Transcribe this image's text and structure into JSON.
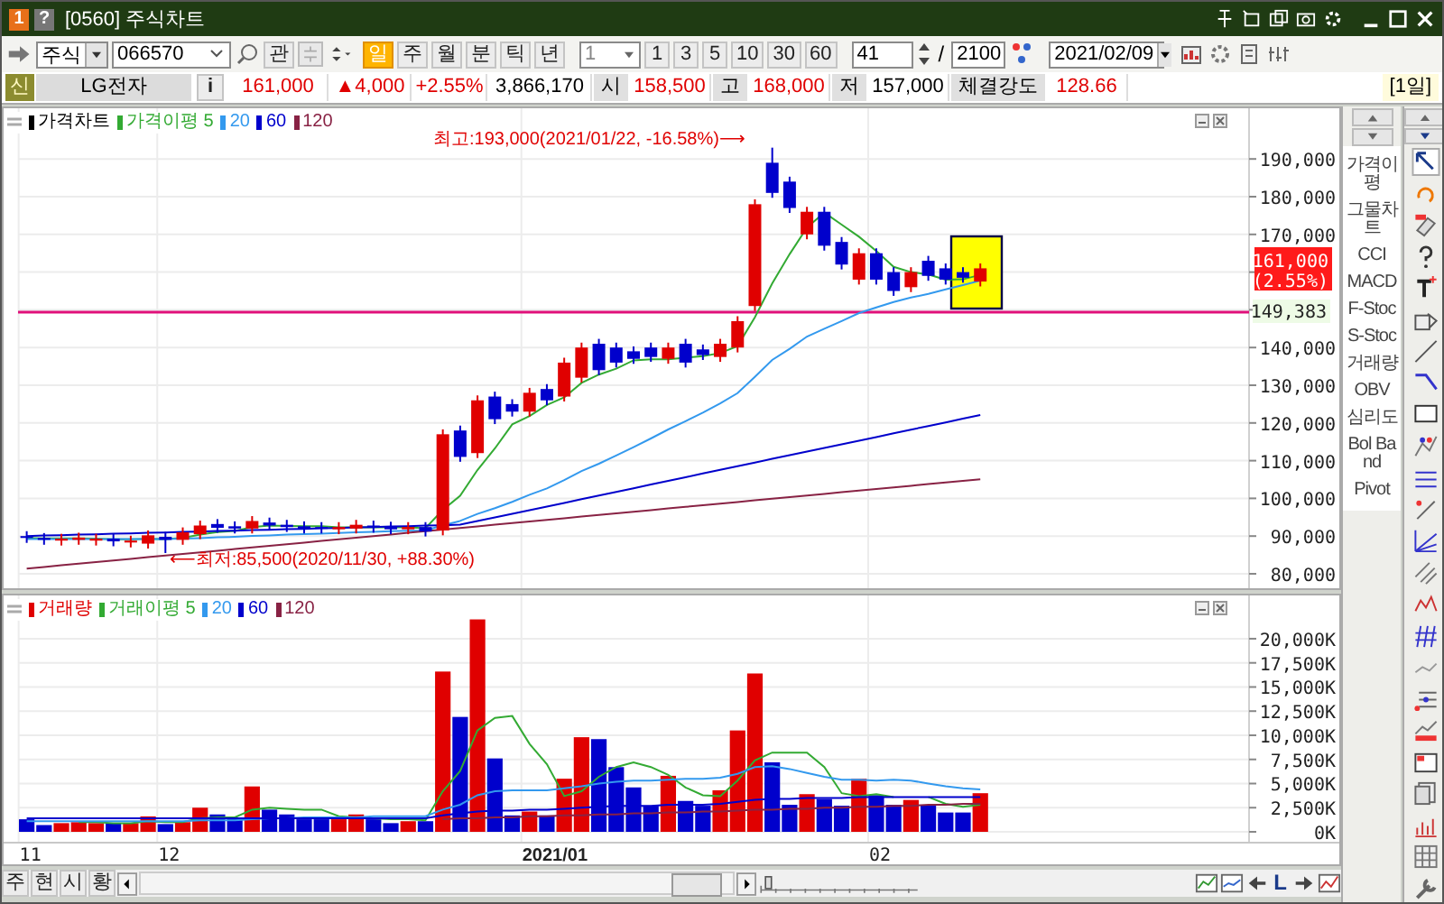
{
  "window": {
    "badge": "1",
    "help": "?",
    "title": "[0560] 주식차트"
  },
  "toolbar": {
    "market": "주식",
    "code": "066570",
    "watch": "관",
    "periods": [
      {
        "label": "일",
        "selected": true
      },
      {
        "label": "주",
        "selected": false
      },
      {
        "label": "월",
        "selected": false
      },
      {
        "label": "분",
        "selected": false
      },
      {
        "label": "틱",
        "selected": false
      },
      {
        "label": "년",
        "selected": false
      }
    ],
    "interval": "1",
    "intervals": [
      "1",
      "3",
      "5",
      "10",
      "30",
      "60"
    ],
    "count": "41",
    "separator": "/",
    "total": "2100",
    "date": "2021/02/09"
  },
  "quote": {
    "tag": "신",
    "name": "LG전자",
    "info": "i",
    "values": [
      {
        "value": "161,000",
        "color": "#e00000"
      },
      {
        "value": "▲4,000",
        "color": "#e00000"
      },
      {
        "value": "+2.55%",
        "color": "#e00000"
      },
      {
        "value": "3,866,170",
        "color": "#000000"
      }
    ],
    "fields": [
      {
        "label": "시",
        "value": "158,500",
        "color": "#e00000"
      },
      {
        "label": "고",
        "value": "168,000",
        "color": "#e00000"
      },
      {
        "label": "저",
        "value": "157,000",
        "color": "#000000"
      },
      {
        "label": "체결강도",
        "value": "128.66",
        "color": "#e00000"
      }
    ],
    "period": "[1일]"
  },
  "price_chart": {
    "legend": [
      {
        "label": "가격차트",
        "color": "#000000"
      },
      {
        "label": "가격이평 5",
        "color": "#33aa33"
      },
      {
        "label": "20",
        "color": "#3399ee"
      },
      {
        "label": "60",
        "color": "#0000cc"
      },
      {
        "label": "120",
        "color": "#882244"
      }
    ],
    "high_note": "최고:193,000(2021/01/22, -16.58%)⟶",
    "low_note": "⟵최저:85,500(2020/11/30, +88.30%)",
    "y_labels": [
      "190,000",
      "180,000",
      "170,000",
      "140,000",
      "130,000",
      "120,000",
      "110,000",
      "100,000",
      "90,000",
      "80,000"
    ],
    "current_price": "161,000",
    "current_rate": "(2.55%)",
    "line_value": "149,383"
  },
  "volume_chart": {
    "chart_data": {
      "type": "bar",
      "grid": true,
      "ylim": [
        0,
        22500
      ],
      "series": [
        {
          "name": "거래량",
          "color": "#e00000",
          "values": [
            null,
            null,
            900,
            1000,
            900,
            null,
            900,
            1600,
            null,
            1000,
            2500,
            null,
            null,
            4700,
            null,
            null,
            null,
            null,
            1300,
            1800,
            null,
            null,
            1100,
            null,
            16600,
            null,
            22000,
            null,
            null,
            2100,
            null,
            5500,
            9800,
            null,
            null,
            null,
            null,
            5800,
            null,
            null,
            4300,
            10500,
            16400,
            null,
            null,
            3900,
            null,
            null,
            5500,
            null,
            null,
            3300,
            null,
            null,
            null,
            4000,
            null,
            null,
            null,
            null,
            null,
            null,
            null,
            null,
            null,
            null,
            null,
            null,
            null,
            null,
            null
          ]
        },
        {
          "color": "#0000cc",
          "values": [
            1300,
            700,
            null,
            null,
            null,
            900,
            null,
            null,
            800,
            null,
            null,
            1800,
            1400,
            null,
            2300,
            1800,
            1300,
            1300,
            null,
            null,
            1300,
            900,
            null,
            1100,
            null,
            11900,
            null,
            7600,
            1700,
            null,
            1700,
            null,
            null,
            9600,
            6700,
            4600,
            2700,
            null,
            3200,
            2700,
            null,
            null,
            null,
            7200,
            2800,
            null,
            3400,
            2700,
            null,
            3800,
            2800,
            null,
            2800,
            2000,
            2000,
            null,
            null,
            null,
            null,
            null,
            null,
            null,
            null,
            null,
            null,
            null,
            null,
            null,
            null,
            null,
            null
          ]
        },
        {
          "name": "거래이평 5",
          "color": "#33aa33",
          "type": "line",
          "values": [
            null,
            null,
            null,
            1000,
            1000,
            900,
            900,
            1100,
            1000,
            1000,
            1400,
            1500,
            1500,
            2300,
            2500,
            2400,
            2300,
            2300,
            1600,
            1500,
            1400,
            1300,
            1300,
            1200,
            4200,
            6300,
            10500,
            11800,
            12000,
            9100,
            7000,
            3700,
            4200,
            5700,
            6700,
            7200,
            6700,
            5900,
            4600,
            3800,
            3700,
            5300,
            7400,
            8200,
            8200,
            8200,
            6700,
            4000,
            3700,
            3900,
            3600,
            null,
            3600,
            2900,
            2600,
            2800,
            null,
            null,
            null,
            null,
            null,
            null,
            null,
            null,
            null,
            null,
            null,
            null,
            null,
            null,
            null
          ]
        },
        {
          "name": "20",
          "color": "#3399ee",
          "type": "line",
          "values": [
            1100,
            1100,
            1100,
            1100,
            1100,
            1100,
            1100,
            1100,
            1100,
            1100,
            1200,
            1200,
            1200,
            1300,
            1400,
            1400,
            1500,
            1500,
            1500,
            1500,
            1600,
            1600,
            1600,
            1600,
            2300,
            2800,
            3800,
            4200,
            4300,
            4300,
            4300,
            4500,
            4700,
            5000,
            5200,
            5300,
            5300,
            5400,
            5500,
            5500,
            5600,
            6000,
            6700,
            6800,
            6500,
            6100,
            5700,
            5400,
            5400,
            5300,
            5400,
            5300,
            5000,
            4700,
            4500,
            4400,
            null,
            null,
            null,
            null,
            null,
            null,
            null,
            null,
            null,
            null,
            null,
            null,
            null,
            null,
            null
          ]
        },
        {
          "name": "60",
          "color": "#0000cc",
          "type": "line",
          "values": [
            1400,
            1400,
            1400,
            1400,
            1400,
            1400,
            1400,
            1400,
            1400,
            1400,
            1400,
            1400,
            1400,
            1400,
            1400,
            1400,
            1400,
            1400,
            1400,
            1400,
            1400,
            1400,
            1400,
            1400,
            1700,
            1900,
            2100,
            2200,
            2200,
            2300,
            2300,
            2400,
            2500,
            2600,
            2700,
            2700,
            2700,
            2800,
            2800,
            2800,
            2900,
            3100,
            3300,
            3400,
            3400,
            3500,
            3500,
            3500,
            3600,
            3600,
            3600,
            3600,
            3600,
            3600,
            3600,
            3600,
            null,
            null,
            null,
            null,
            null,
            null,
            null,
            null,
            null,
            null,
            null,
            null,
            null,
            null,
            null
          ]
        },
        {
          "name": "120",
          "color": "#882244",
          "type": "line",
          "values": [
            null,
            null,
            null,
            null,
            null,
            null,
            null,
            null,
            null,
            null,
            null,
            null,
            null,
            null,
            null,
            null,
            null,
            null,
            null,
            null,
            null,
            null,
            null,
            null,
            1300,
            1400,
            1400,
            1500,
            1500,
            1600,
            1600,
            1700,
            1700,
            1800,
            1800,
            1900,
            1900,
            2000,
            2000,
            2100,
            2100,
            2200,
            2300,
            2300,
            2400,
            2400,
            2500,
            2500,
            2600,
            2600,
            2700,
            2700,
            2800,
            2800,
            2900,
            2900,
            null,
            null,
            null,
            null,
            null,
            null,
            null,
            null,
            null,
            null,
            null,
            null,
            null,
            null,
            null
          ]
        }
      ],
      "yticks": [
        {
          "value": 20000,
          "label": "20,000K"
        },
        {
          "value": 17500,
          "label": "17,500K"
        },
        {
          "value": 15000,
          "label": "15,000K"
        },
        {
          "value": 12500,
          "label": "12,500K"
        },
        {
          "value": 10000,
          "label": "10,000K"
        },
        {
          "value": 7500,
          "label": "7,500K"
        },
        {
          "value": 5000,
          "label": "5,000K"
        },
        {
          "value": 2500,
          "label": "2,500K"
        },
        {
          "value": 0,
          "label": "0K"
        }
      ]
    },
    "x_labels": [
      {
        "label": "11",
        "bold": false
      },
      {
        "label": "12",
        "bold": false
      },
      {
        "label": "2021/01",
        "bold": true
      },
      {
        "label": "02",
        "bold": false
      }
    ]
  },
  "indicators": [
    "가격이평",
    "그물차트",
    "CCI",
    "MACD",
    "F-Stoc",
    "S-Stoc",
    "거래량",
    "OBV",
    "심리도",
    "Bol Band",
    "Pivot"
  ],
  "bottom_tabs": [
    "주",
    "현",
    "시",
    "황"
  ],
  "zoom_slider": {
    "level": 0.03
  },
  "nav_label": "L"
}
